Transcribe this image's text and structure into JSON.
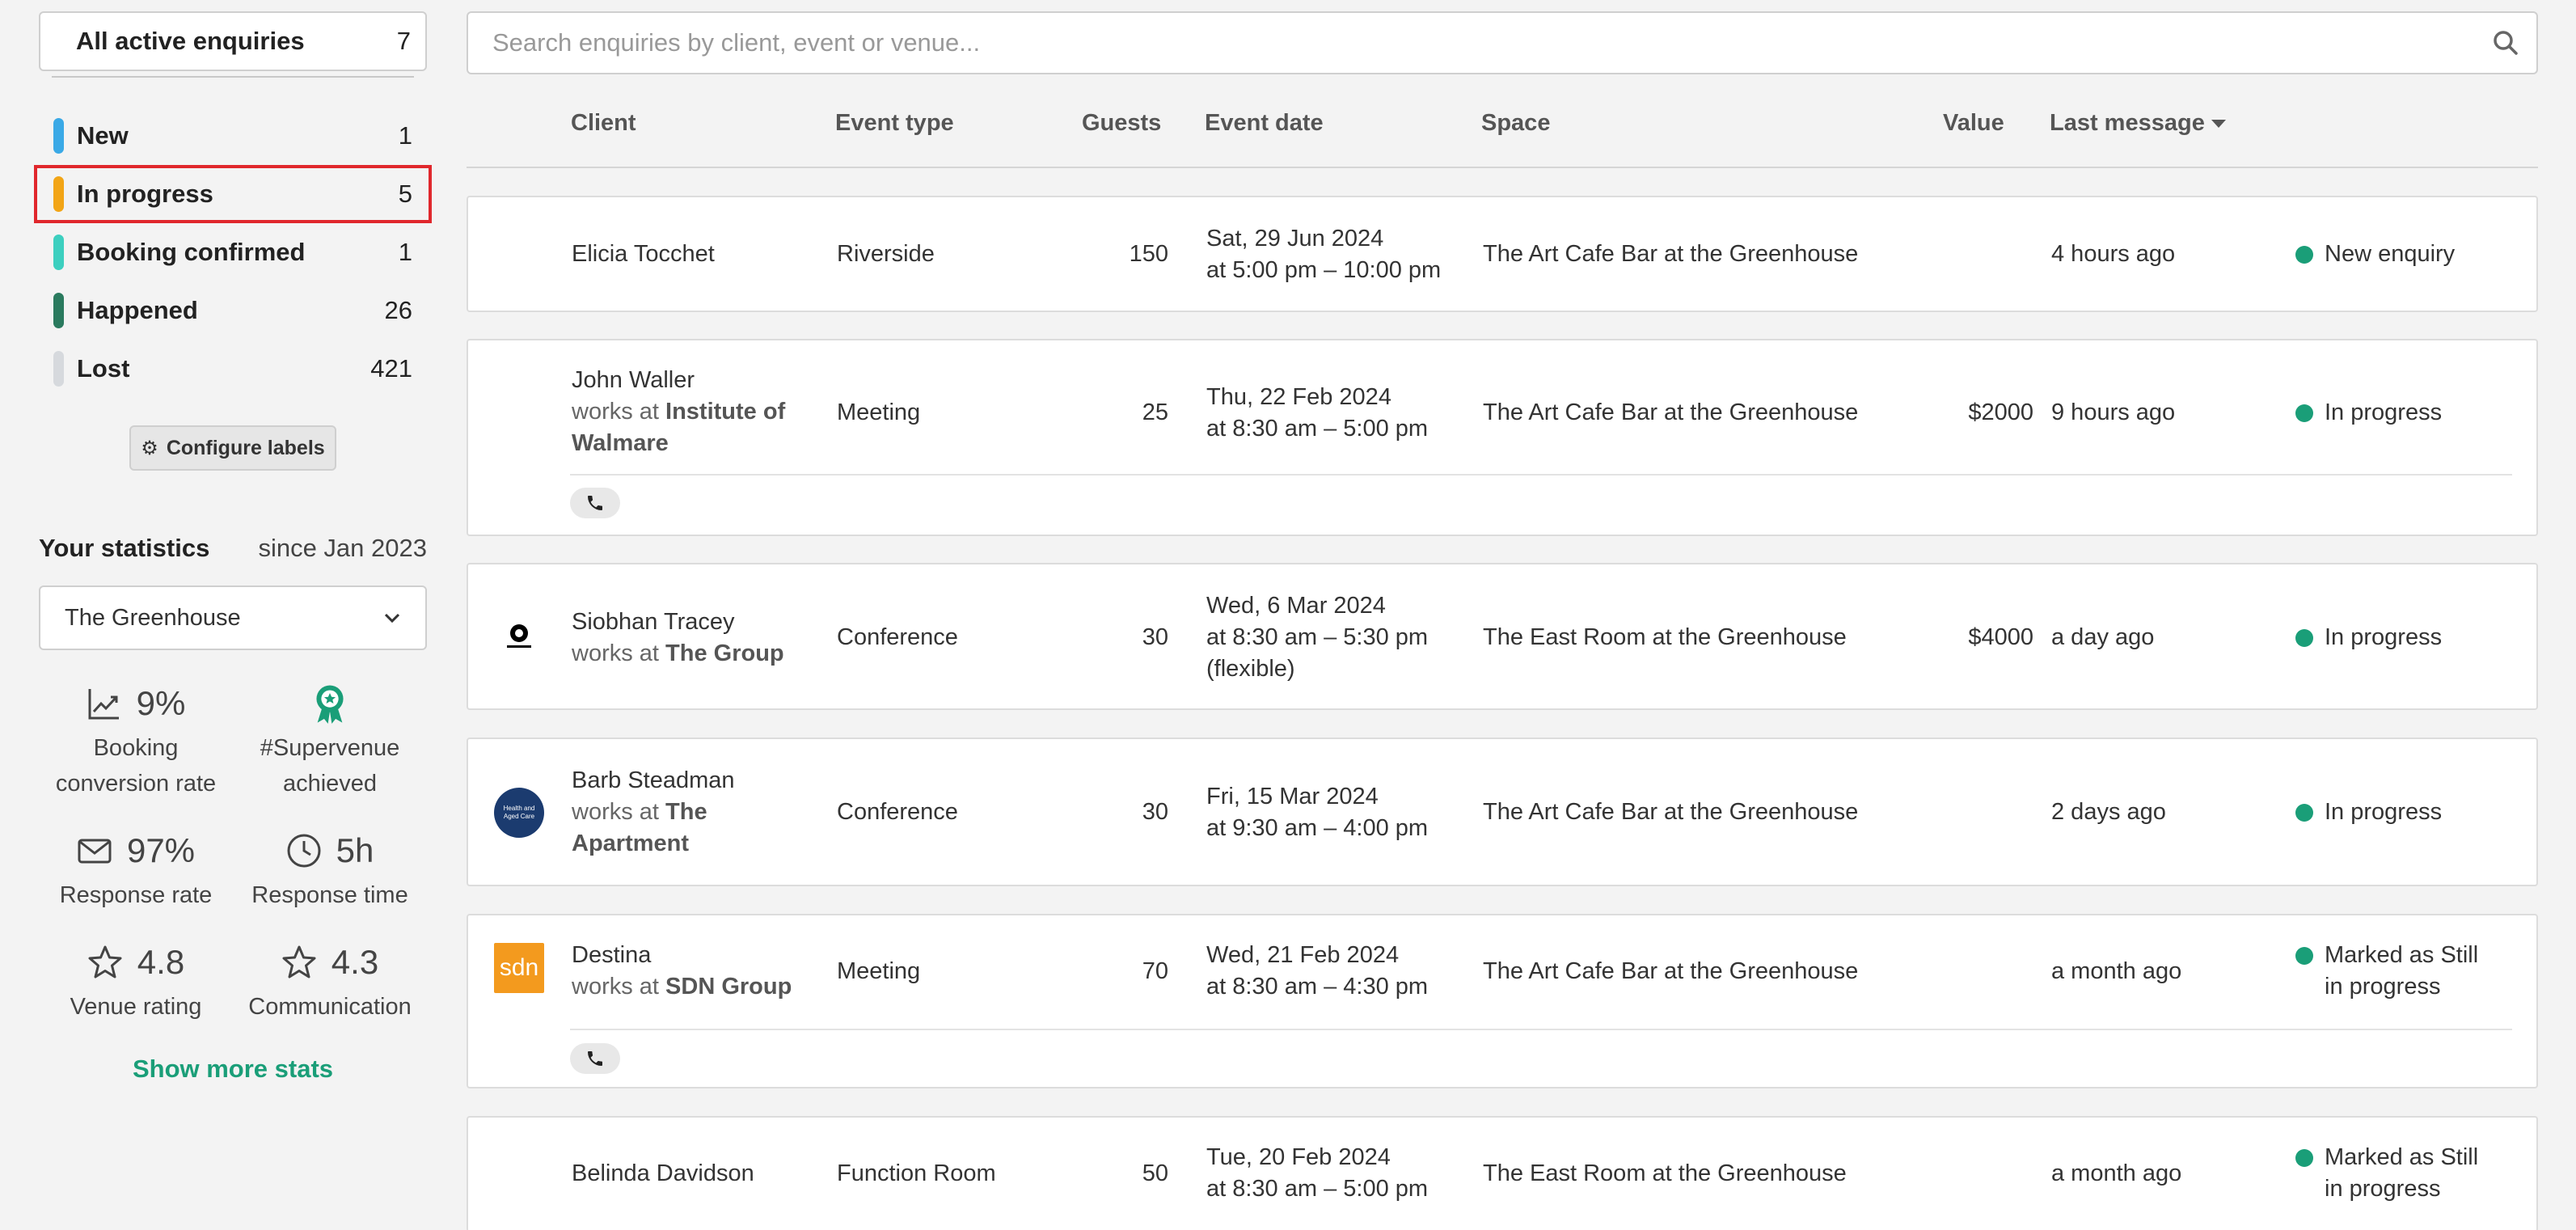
{
  "sidebar": {
    "all_active": {
      "label": "All active enquiries",
      "count": "7"
    },
    "labels": [
      {
        "label": "New",
        "count": "1",
        "color": "#3aa9e6"
      },
      {
        "label": "In progress",
        "count": "5",
        "color": "#f2a516"
      },
      {
        "label": "Booking confirmed",
        "count": "1",
        "color": "#3ccfbf"
      },
      {
        "label": "Happened",
        "count": "26",
        "color": "#2a7a5e"
      },
      {
        "label": "Lost",
        "count": "421",
        "color": "#d6d9dd"
      }
    ],
    "configure_label": "Configure labels",
    "stats": {
      "title": "Your statistics",
      "since": "since Jan 2023",
      "venue": "The Greenhouse",
      "items": [
        {
          "value": "9%",
          "label1": "Booking",
          "label2": "conversion rate",
          "icon": "trend-chart-icon"
        },
        {
          "value": "",
          "label1": "#Supervenue",
          "label2": "achieved",
          "icon": "award-ribbon-icon"
        },
        {
          "value": "97%",
          "label1": "Response rate",
          "label2": "",
          "icon": "envelope-icon"
        },
        {
          "value": "5h",
          "label1": "Response time",
          "label2": "",
          "icon": "clock-icon"
        },
        {
          "value": "4.8",
          "label1": "Venue rating",
          "label2": "",
          "icon": "star-icon"
        },
        {
          "value": "4.3",
          "label1": "Communication",
          "label2": "",
          "icon": "star-icon"
        }
      ],
      "show_more": "Show more stats"
    }
  },
  "search": {
    "placeholder": "Search enquiries by client, event or venue..."
  },
  "table": {
    "headers": {
      "client": "Client",
      "event_type": "Event type",
      "guests": "Guests",
      "event_date": "Event date",
      "space": "Space",
      "value": "Value",
      "last_message": "Last message"
    },
    "rows": [
      {
        "client": "Elicia Tocchet",
        "works_at_prefix": "",
        "company1": "",
        "company2": "",
        "event_type": "Riverside",
        "guests": "150",
        "date1": "Sat, 29 Jun 2024",
        "date2": "at 5:00 pm – 10:00 pm",
        "date3": "",
        "space": "The Art Cafe Bar at the Greenhouse",
        "value": "",
        "last_message": "4 hours ago",
        "status1": "New enquiry",
        "status2": "",
        "logo": ""
      },
      {
        "client": "John Waller",
        "works_at_prefix": "works at ",
        "company1": "Institute of",
        "company2": "Walmare",
        "event_type": "Meeting",
        "guests": "25",
        "date1": "Thu, 22 Feb 2024",
        "date2": "at 8:30 am – 5:00 pm",
        "date3": "",
        "space": "The Art Cafe Bar at the Greenhouse",
        "value": "$2000",
        "last_message": "9 hours ago",
        "status1": "In progress",
        "status2": "",
        "logo": ""
      },
      {
        "client": "Siobhan Tracey",
        "works_at_prefix": "works at ",
        "company1": "The Group",
        "company2": "",
        "event_type": "Conference",
        "guests": "30",
        "date1": "Wed, 6 Mar 2024",
        "date2": "at 8:30 am – 5:30 pm",
        "date3": "(flexible)",
        "space": "The East Room at the Greenhouse",
        "value": "$4000",
        "last_message": "a day ago",
        "status1": "In progress",
        "status2": "",
        "logo": "MACQUARIE"
      },
      {
        "client": "Barb Steadman",
        "works_at_prefix": "works at ",
        "company1": "The",
        "company2": "Apartment",
        "event_type": "Conference",
        "guests": "30",
        "date1": "Fri, 15 Mar 2024",
        "date2": "at 9:30 am – 4:00 pm",
        "date3": "",
        "space": "The Art Cafe Bar at the Greenhouse",
        "value": "",
        "last_message": "2 days ago",
        "status1": "In progress",
        "status2": "",
        "logo": "Health and Aged Care"
      },
      {
        "client": "Destina",
        "works_at_prefix": "works at ",
        "company1": "SDN Group",
        "company2": "",
        "event_type": "Meeting",
        "guests": "70",
        "date1": "Wed, 21 Feb 2024",
        "date2": "at 8:30 am – 4:30 pm",
        "date3": "",
        "space": "The Art Cafe Bar at the Greenhouse",
        "value": "",
        "last_message": "a month ago",
        "status1": "Marked as Still",
        "status2": "in progress",
        "logo": "sdn"
      },
      {
        "client": "Belinda Davidson",
        "works_at_prefix": "",
        "company1": "",
        "company2": "",
        "event_type": "Function Room",
        "guests": "50",
        "date1": "Tue, 20 Feb 2024",
        "date2": "at 8:30 am – 5:00 pm",
        "date3": "",
        "space": "The East Room at the Greenhouse",
        "value": "",
        "last_message": "a month ago",
        "status1": "Marked as Still",
        "status2": "in progress",
        "logo": ""
      }
    ]
  },
  "colors": {
    "accent": "#1a9e78",
    "selected_outline": "#e0272c"
  }
}
